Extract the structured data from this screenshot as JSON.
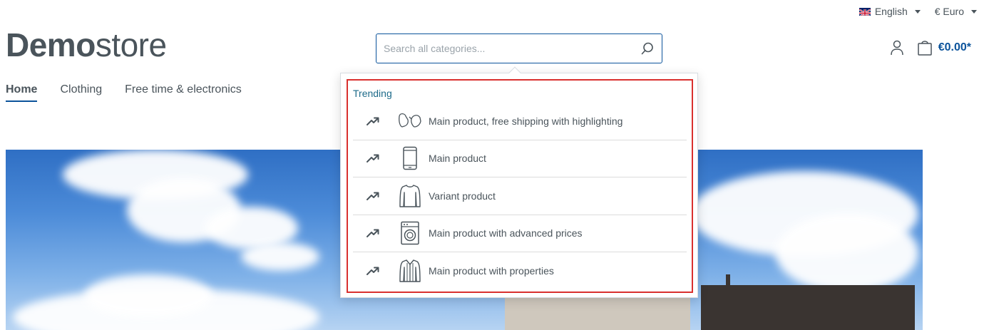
{
  "topbar": {
    "language": "English",
    "currency": "€ Euro"
  },
  "logo": {
    "bold": "Demo",
    "light": "store"
  },
  "search": {
    "placeholder": "Search all categories..."
  },
  "header": {
    "cart_total": "€0.00*"
  },
  "nav": {
    "items": [
      {
        "label": "Home",
        "active": true
      },
      {
        "label": "Clothing"
      },
      {
        "label": "Free time & electronics"
      }
    ]
  },
  "dropdown": {
    "heading": "Trending",
    "items": [
      {
        "name": "Main product, free shipping with highlighting",
        "icon": "mittens-icon"
      },
      {
        "name": "Main product",
        "icon": "smartphone-icon"
      },
      {
        "name": "Variant product",
        "icon": "shirt-icon"
      },
      {
        "name": "Main product with advanced prices",
        "icon": "washing-machine-icon"
      },
      {
        "name": "Main product with properties",
        "icon": "jacket-icon"
      }
    ]
  },
  "colors": {
    "accent": "#0b539b",
    "highlight_border": "#d9302e",
    "text": "#4a545b",
    "trending": "#1e6b8a"
  }
}
